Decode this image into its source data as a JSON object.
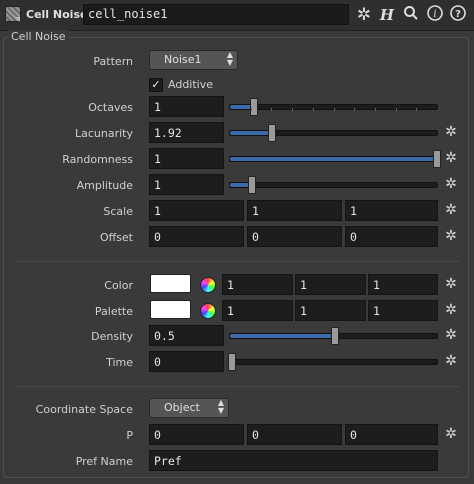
{
  "header": {
    "node_type": "Cell Noise",
    "node_name": "cell_noise1",
    "icons": [
      "gear-icon",
      "help-h-icon",
      "search-icon",
      "info-icon",
      "help-icon"
    ]
  },
  "folder": {
    "title": "Cell Noise"
  },
  "params": {
    "pattern": {
      "label": "Pattern",
      "value": "Noise1"
    },
    "additive": {
      "label": "Additive",
      "checked": true
    },
    "octaves": {
      "label": "Octaves",
      "value": "1",
      "level": 0.11
    },
    "lacunarity": {
      "label": "Lacunarity",
      "value": "1.92",
      "level": 0.2
    },
    "randomness": {
      "label": "Randomness",
      "value": "1",
      "level": 1.0
    },
    "amplitude": {
      "label": "Amplitude",
      "value": "1",
      "level": 0.1
    },
    "scale": {
      "label": "Scale",
      "values": [
        "1",
        "1",
        "1"
      ]
    },
    "offset": {
      "label": "Offset",
      "values": [
        "0",
        "0",
        "0"
      ]
    },
    "color": {
      "label": "Color",
      "swatch": "#ffffff",
      "values": [
        "1",
        "1",
        "1"
      ]
    },
    "palette": {
      "label": "Palette",
      "swatch": "#ffffff",
      "values": [
        "1",
        "1",
        "1"
      ]
    },
    "density": {
      "label": "Density",
      "value": "0.5",
      "level": 0.5
    },
    "time": {
      "label": "Time",
      "value": "0",
      "level": 0.0
    },
    "coordinate_space": {
      "label": "Coordinate Space",
      "value": "Object"
    },
    "p": {
      "label": "P",
      "values": [
        "0",
        "0",
        "0"
      ]
    },
    "pref_name": {
      "label": "Pref Name",
      "value": "Pref"
    }
  },
  "colors": {
    "slider_fill": "#3c6aa8",
    "background": "#3a3a3a",
    "field_bg": "#1d1d1d"
  }
}
